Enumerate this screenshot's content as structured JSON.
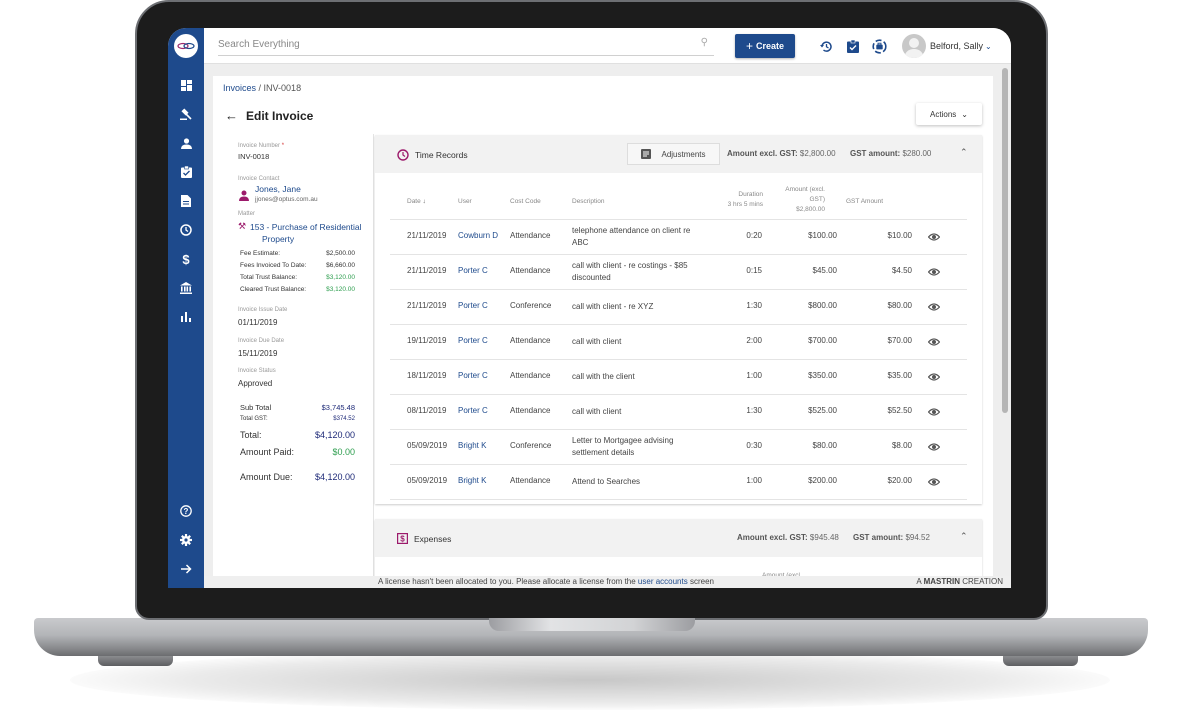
{
  "app": {
    "search_placeholder": "Search Everything",
    "create_label": "Create",
    "user_name": "Belford, Sally",
    "brand_color": "#1e4a8c"
  },
  "sidebar": {
    "items": [
      {
        "icon": "dashboard-icon"
      },
      {
        "icon": "gavel-icon"
      },
      {
        "icon": "person-icon"
      },
      {
        "icon": "clipboard-check-icon"
      },
      {
        "icon": "document-icon"
      },
      {
        "icon": "clock-icon"
      },
      {
        "icon": "dollar-icon"
      },
      {
        "icon": "bank-icon"
      },
      {
        "icon": "bar-chart-icon"
      }
    ],
    "bottom_items": [
      {
        "icon": "help-icon"
      },
      {
        "icon": "settings-icon"
      },
      {
        "icon": "arrow-right-icon"
      }
    ]
  },
  "page": {
    "breadcrumb_root": "Invoices",
    "breadcrumb_sep": " / ",
    "breadcrumb_current": "INV-0018",
    "title": "Edit Invoice",
    "actions_label": "Actions"
  },
  "invoice": {
    "number_label": "Invoice Number",
    "number": "INV-0018",
    "contact_label": "Invoice Contact",
    "contact_name": "Jones, Jane",
    "contact_email": "jjones@optus.com.au",
    "matter_label": "Matter",
    "matter_line1": "153 - Purchase of Residential",
    "matter_line2": "Property",
    "fee_estimate_label": "Fee Estimate:",
    "fee_estimate": "$2,500.00",
    "fees_invoiced_label": "Fees Invoiced To Date:",
    "fees_invoiced": "$6,660.00",
    "total_trust_label": "Total Trust Balance:",
    "total_trust": "$3,120.00",
    "cleared_trust_label": "Cleared Trust Balance:",
    "cleared_trust": "$3,120.00",
    "issue_date_label": "Invoice Issue Date",
    "issue_date": "01/11/2019",
    "due_date_label": "Invoice Due Date",
    "due_date": "15/11/2019",
    "status_label": "Invoice Status",
    "status": "Approved",
    "subtotal_label": "Sub Total",
    "subtotal": "$3,745.48",
    "total_gst_label": "Total GST:",
    "total_gst": "$374.52",
    "total_label": "Total:",
    "total": "$4,120.00",
    "amount_paid_label": "Amount Paid:",
    "amount_paid": "$0.00",
    "amount_due_label": "Amount Due:",
    "amount_due": "$4,120.00"
  },
  "time_records": {
    "title": "Time Records",
    "adjustments_label": "Adjustments",
    "amount_excl_label": "Amount excl. GST:",
    "amount_excl": "$2,800.00",
    "gst_label": "GST amount:",
    "gst": "$280.00",
    "columns": {
      "date": "Date",
      "user": "User",
      "cost_code": "Cost Code",
      "description": "Description",
      "duration": "Duration",
      "duration_total": "3 hrs 5 mins",
      "amount_line1": "Amount (excl.",
      "amount_line2": "GST)",
      "amount_total": "$2,800.00",
      "gst_amount": "GST Amount"
    },
    "rows": [
      {
        "date": "21/11/2019",
        "user": "Cowburn D",
        "code": "Attendance",
        "desc": "telephone attendance on client re ABC",
        "dur": "0:20",
        "amount": "$100.00",
        "gst": "$10.00"
      },
      {
        "date": "21/11/2019",
        "user": "Porter C",
        "code": "Attendance",
        "desc": "call with client - re costings - $85 discounted",
        "dur": "0:15",
        "amount": "$45.00",
        "gst": "$4.50"
      },
      {
        "date": "21/11/2019",
        "user": "Porter C",
        "code": "Conference",
        "desc": "call with client - re XYZ",
        "dur": "1:30",
        "amount": "$800.00",
        "gst": "$80.00"
      },
      {
        "date": "19/11/2019",
        "user": "Porter C",
        "code": "Attendance",
        "desc": "call with client",
        "dur": "2:00",
        "amount": "$700.00",
        "gst": "$70.00"
      },
      {
        "date": "18/11/2019",
        "user": "Porter C",
        "code": "Attendance",
        "desc": "call with the client",
        "dur": "1:00",
        "amount": "$350.00",
        "gst": "$35.00"
      },
      {
        "date": "08/11/2019",
        "user": "Porter C",
        "code": "Attendance",
        "desc": "call with client",
        "dur": "1:30",
        "amount": "$525.00",
        "gst": "$52.50"
      },
      {
        "date": "05/09/2019",
        "user": "Bright K",
        "code": "Conference",
        "desc": "Letter to Mortgagee advising settlement details",
        "dur": "0:30",
        "amount": "$80.00",
        "gst": "$8.00"
      },
      {
        "date": "05/09/2019",
        "user": "Bright K",
        "code": "Attendance",
        "desc": "Attend to Searches",
        "dur": "1:00",
        "amount": "$200.00",
        "gst": "$20.00"
      }
    ]
  },
  "expenses": {
    "title": "Expenses",
    "amount_excl_label": "Amount excl. GST:",
    "amount_excl": "$945.48",
    "gst_label": "GST amount:",
    "gst": "$94.52",
    "partial_header": "Amount (excl."
  },
  "footer": {
    "notice_prefix": "A license hasn't been allocated to you. Please allocate a license from the",
    "notice_link": "user accounts",
    "notice_suffix": "screen",
    "credit_prefix": "A",
    "credit_brand": "MASTRIN",
    "credit_suffix": "CREATION"
  }
}
